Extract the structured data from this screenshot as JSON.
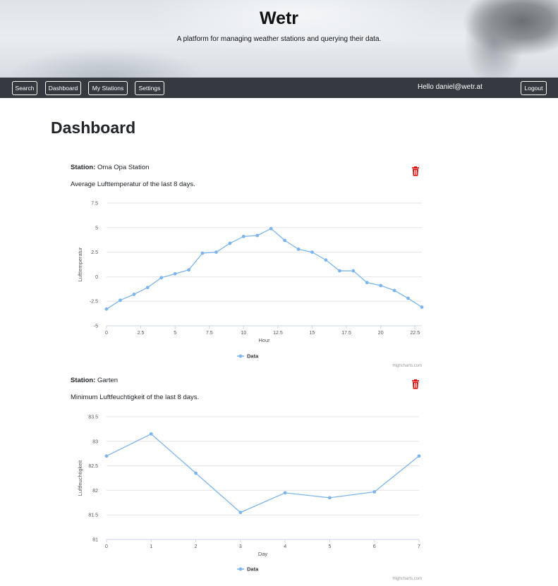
{
  "header": {
    "title": "Wetr",
    "subtitle": "A platform for managing weather stations and querying their data."
  },
  "nav": {
    "search": "Search",
    "dashboard": "Dashboard",
    "my_stations": "My Stations",
    "settings": "Settings",
    "greeting": "Hello daniel@wetr.at",
    "logout": "Logout"
  },
  "page": {
    "title": "Dashboard"
  },
  "colors": {
    "navbar": "#343a40",
    "series": "#7cb5ec",
    "delete": "#dc0000"
  },
  "widgets": [
    {
      "station_label": "Station:",
      "station_name": "Oma Opa Station",
      "description": "Average Lufttemperatur of the last 8 days.",
      "delete_icon": "trash-icon"
    },
    {
      "station_label": "Station:",
      "station_name": "Garten",
      "description": "Minimum Luftfeuchtigkeit of the last 8 days.",
      "delete_icon": "trash-icon"
    }
  ],
  "chart_data": [
    {
      "type": "line",
      "xlabel": "Hour",
      "ylabel": "Lufttemperatur",
      "ylim": [
        -5,
        7.5
      ],
      "xlim": [
        0,
        23
      ],
      "y_ticks": [
        "7.5",
        "5",
        "2.5",
        "0",
        "-2.5",
        "-5"
      ],
      "y_tick_values": [
        7.5,
        5,
        2.5,
        0,
        -2.5,
        -5
      ],
      "x_ticks": [
        "0",
        "2.5",
        "5",
        "7.5",
        "10",
        "12.5",
        "15",
        "17.5",
        "20",
        "22.5"
      ],
      "x_tick_values": [
        0,
        2.5,
        5,
        7.5,
        10,
        12.5,
        15,
        17.5,
        20,
        22.5
      ],
      "x": [
        0,
        1,
        2,
        3,
        4,
        5,
        6,
        7,
        8,
        9,
        10,
        11,
        12,
        13,
        14,
        15,
        16,
        17,
        18,
        19,
        20,
        21,
        22,
        23
      ],
      "series": [
        {
          "name": "Data",
          "values": [
            -3.3,
            -2.4,
            -1.8,
            -1.1,
            -0.1,
            0.3,
            0.7,
            2.4,
            2.5,
            3.4,
            4.1,
            4.2,
            4.9,
            3.7,
            2.8,
            2.5,
            1.7,
            0.6,
            0.6,
            -0.6,
            -0.9,
            -1.4,
            -2.2,
            -3.1
          ]
        }
      ],
      "legend": "bottom-center",
      "credits": "Highcharts.com",
      "grid": true
    },
    {
      "type": "line",
      "xlabel": "Day",
      "ylabel": "Luftfeuchtigkeit",
      "ylim": [
        81,
        83.5
      ],
      "xlim": [
        0,
        7
      ],
      "y_ticks": [
        "83.5",
        "83",
        "82.5",
        "82",
        "81.5",
        "81"
      ],
      "y_tick_values": [
        83.5,
        83,
        82.5,
        82,
        81.5,
        81
      ],
      "x_ticks": [
        "0",
        "1",
        "2",
        "3",
        "4",
        "5",
        "6",
        "7"
      ],
      "x_tick_values": [
        0,
        1,
        2,
        3,
        4,
        5,
        6,
        7
      ],
      "x": [
        0,
        1,
        2,
        3,
        4,
        5,
        6,
        7
      ],
      "series": [
        {
          "name": "Data",
          "values": [
            82.7,
            83.15,
            82.35,
            81.55,
            81.95,
            81.85,
            81.97,
            82.7
          ]
        }
      ],
      "legend": "bottom-center",
      "credits": "Highcharts.com",
      "grid": true
    }
  ]
}
